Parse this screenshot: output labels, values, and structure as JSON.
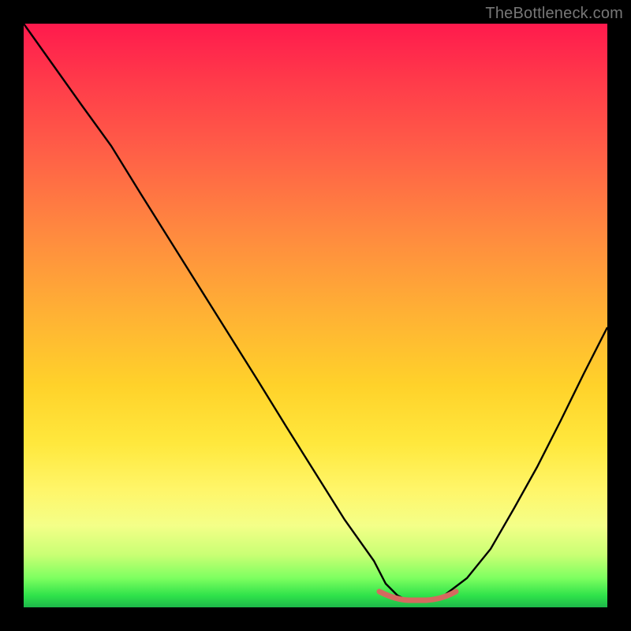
{
  "watermark": {
    "text": "TheBottleneck.com"
  },
  "chart_data": {
    "type": "line",
    "title": "",
    "xlabel": "",
    "ylabel": "",
    "xlim": [
      0,
      100
    ],
    "ylim": [
      0,
      100
    ],
    "grid": false,
    "legend": false,
    "x": [
      0,
      5,
      10,
      15,
      20,
      25,
      30,
      35,
      40,
      45,
      50,
      55,
      60,
      62,
      64,
      66,
      68,
      70,
      72,
      76,
      80,
      84,
      88,
      92,
      96,
      100
    ],
    "values": [
      100,
      93,
      86,
      79,
      71,
      63,
      55,
      47,
      39,
      31,
      23,
      15,
      8,
      4,
      2,
      1,
      1,
      1,
      2,
      5,
      10,
      17,
      24,
      32,
      40,
      48
    ],
    "valley_marker": {
      "x_range": [
        61,
        74
      ],
      "y": 2,
      "color": "#d56a5f"
    },
    "background_gradient": {
      "stops": [
        {
          "pos": 0.0,
          "color": "#ff1a4d"
        },
        {
          "pos": 0.36,
          "color": "#ff8a3f"
        },
        {
          "pos": 0.62,
          "color": "#ffd22a"
        },
        {
          "pos": 0.86,
          "color": "#f4ff88"
        },
        {
          "pos": 0.98,
          "color": "#2fe24a"
        },
        {
          "pos": 1.0,
          "color": "#1db84a"
        }
      ]
    }
  }
}
